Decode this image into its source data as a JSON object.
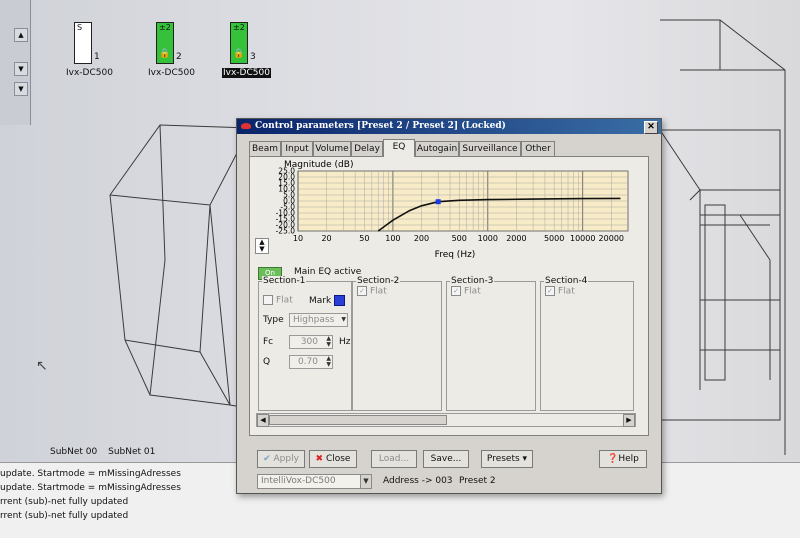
{
  "devices": [
    {
      "top_label": "S",
      "number": "1",
      "name": "Ivx-DC500",
      "active": false,
      "selected": false
    },
    {
      "top_label": "±2",
      "number": "2",
      "name": "Ivx-DC500",
      "active": true,
      "selected": false
    },
    {
      "top_label": "±2",
      "number": "3",
      "name": "Ivx-DC500",
      "active": true,
      "selected": true
    }
  ],
  "subnets": [
    "SubNet 00",
    "SubNet 01"
  ],
  "log": [
    "update. Startmode = mMissingAdresses",
    "update. Startmode = mMissingAdresses",
    "rrent (sub)-net fully updated",
    "rrent (sub)-net fully updated"
  ],
  "dialog": {
    "title": "Control parameters [Preset 2 / Preset 2] (Locked)",
    "close_glyph": "✕",
    "tabs": [
      "Beam",
      "Input",
      "Volume",
      "Delay",
      "EQ",
      "Autogain",
      "Surveillance",
      "Other"
    ],
    "active_tab": "EQ",
    "on_label": "On",
    "main_eq_label": "Main EQ active",
    "sections": [
      {
        "title": "Section-1",
        "flat": "Flat",
        "mark": "Mark",
        "type_label": "Type",
        "type_value": "Highpass",
        "fc_label": "Fc",
        "fc_value": "300",
        "fc_unit": "Hz",
        "q_label": "Q",
        "q_value": "0.70"
      },
      {
        "title": "Section-2",
        "flat": "Flat"
      },
      {
        "title": "Section-3",
        "flat": "Flat"
      },
      {
        "title": "Section-4",
        "flat": "Flat"
      }
    ],
    "buttons": {
      "apply": "Apply",
      "close": "Close",
      "load": "Load...",
      "save": "Save...",
      "presets": "Presets",
      "help": "Help"
    },
    "combo_value": "IntelliVox-DC500",
    "address": "Address -> 003",
    "preset": "Preset 2"
  },
  "chart_data": {
    "type": "line",
    "title": "Magnitude (dB)",
    "xlabel": "Freq (Hz)",
    "ylabel": "",
    "x_scale": "log",
    "xlim": [
      10,
      30000
    ],
    "ylim": [
      -25,
      25
    ],
    "x_ticks": [
      "10",
      "20",
      "50",
      "100",
      "200",
      "500",
      "1000",
      "2000",
      "5000",
      "10000",
      "20000"
    ],
    "y_ticks": [
      "25.0",
      "20.0",
      "15.0",
      "10.0",
      "5.0",
      "0.0",
      "-5.0",
      "-10.0",
      "-15.0",
      "-20.0",
      "-25.0"
    ],
    "grid": true,
    "series": [
      {
        "x": [
          70,
          100,
          150,
          200,
          300,
          500,
          1000,
          3000,
          10000,
          25000
        ],
        "y": [
          -25,
          -16,
          -8,
          -4,
          -0.6,
          0.6,
          1.2,
          1.6,
          2.0,
          2.2
        ]
      }
    ],
    "marker": {
      "x": 300,
      "y": -0.6,
      "color": "#1a3be0"
    },
    "plot_bg": "#f7ebc8",
    "line_color": "#111111"
  }
}
